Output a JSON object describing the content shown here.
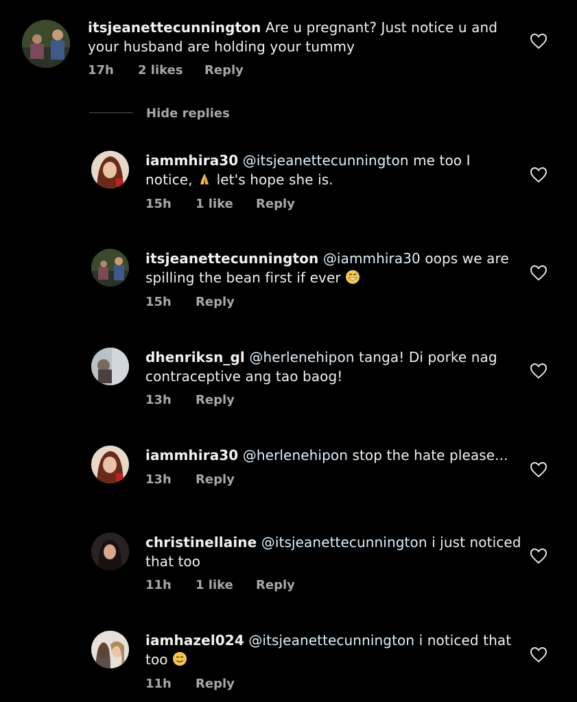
{
  "hide_replies": "Hide replies",
  "comments": [
    {
      "username": "itsjeanettecunnington",
      "mention": "",
      "text": "Are u pregnant? Just notice u and",
      "text2": "your husband are holding your tummy",
      "time": "17h",
      "likes": "2 likes",
      "reply": "Reply"
    },
    {
      "username": "iammhira30",
      "mention": "@itsjeanettecunnington",
      "text": " me too I",
      "text2a": "notice,",
      "text2b": "let's hope she is.",
      "time": "15h",
      "likes": "1 like",
      "reply": "Reply"
    },
    {
      "username": "itsjeanettecunnington",
      "mention": "@iammhira30",
      "text": "oops we are",
      "text2": "spilling the bean first if ever",
      "time": "15h",
      "reply": "Reply"
    },
    {
      "username": "dhenriksn_gl",
      "mention": "@herlenehipon",
      "text": "tanga! Di porke nag",
      "text2": "contraceptive ang tao baog!",
      "time": "13h",
      "reply": "Reply"
    },
    {
      "username": "iammhira30",
      "mention": "@herlenehipon",
      "text": "stop the hate please...",
      "time": "13h",
      "reply": "Reply"
    },
    {
      "username": "christinellaine",
      "mention": "@itsjeanettecunnington",
      "text": "i just noticed",
      "text2": "that too",
      "time": "11h",
      "likes": "1 like",
      "reply": "Reply"
    },
    {
      "username": "iamhazel024",
      "mention": "@itsjeanettecunnington",
      "text": "i noticed that",
      "text2": "too",
      "time": "11h",
      "reply": "Reply"
    }
  ],
  "icons": {
    "like": "heart-outline-icon",
    "pray": "folded-hands-emoji",
    "smile": "grinning-sweat-emoji",
    "blush": "smiling-face-emoji"
  }
}
